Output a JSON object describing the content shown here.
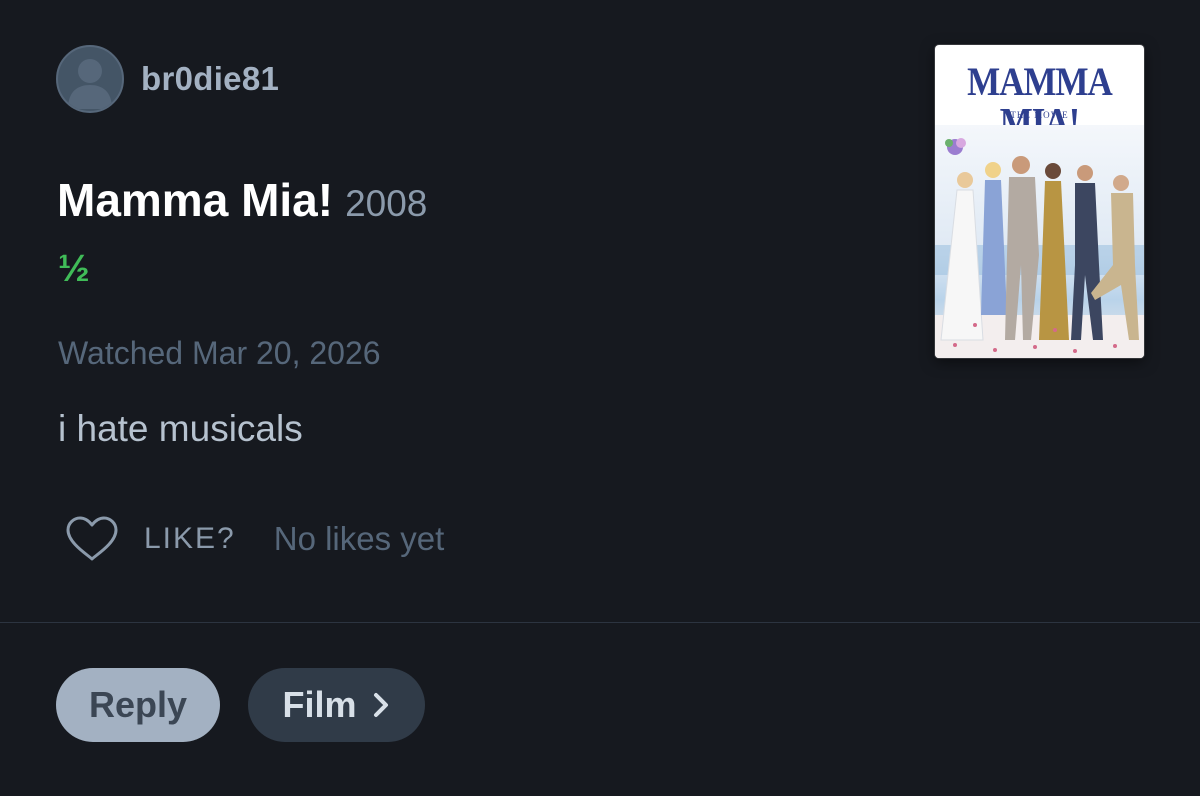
{
  "user": {
    "username": "br0die81",
    "avatar_icon": "default-user-avatar-icon"
  },
  "film": {
    "title": "Mamma Mia!",
    "year": "2008",
    "rating": "½",
    "watched": "Watched Mar 20, 2026",
    "review": "i hate musicals",
    "poster": {
      "title": "MAMMA MIA!",
      "subtitle": "THE MOVIE"
    }
  },
  "likes": {
    "icon": "heart-outline-icon",
    "label": "LIKE?",
    "count_text": "No likes yet"
  },
  "actions": {
    "reply_label": "Reply",
    "film_label": "Film",
    "film_icon": "chevron-right-icon"
  },
  "colors": {
    "background": "#16191f",
    "rating_green": "#40bc58",
    "reply_button": "#a3b1c2",
    "film_button": "#303b48"
  }
}
